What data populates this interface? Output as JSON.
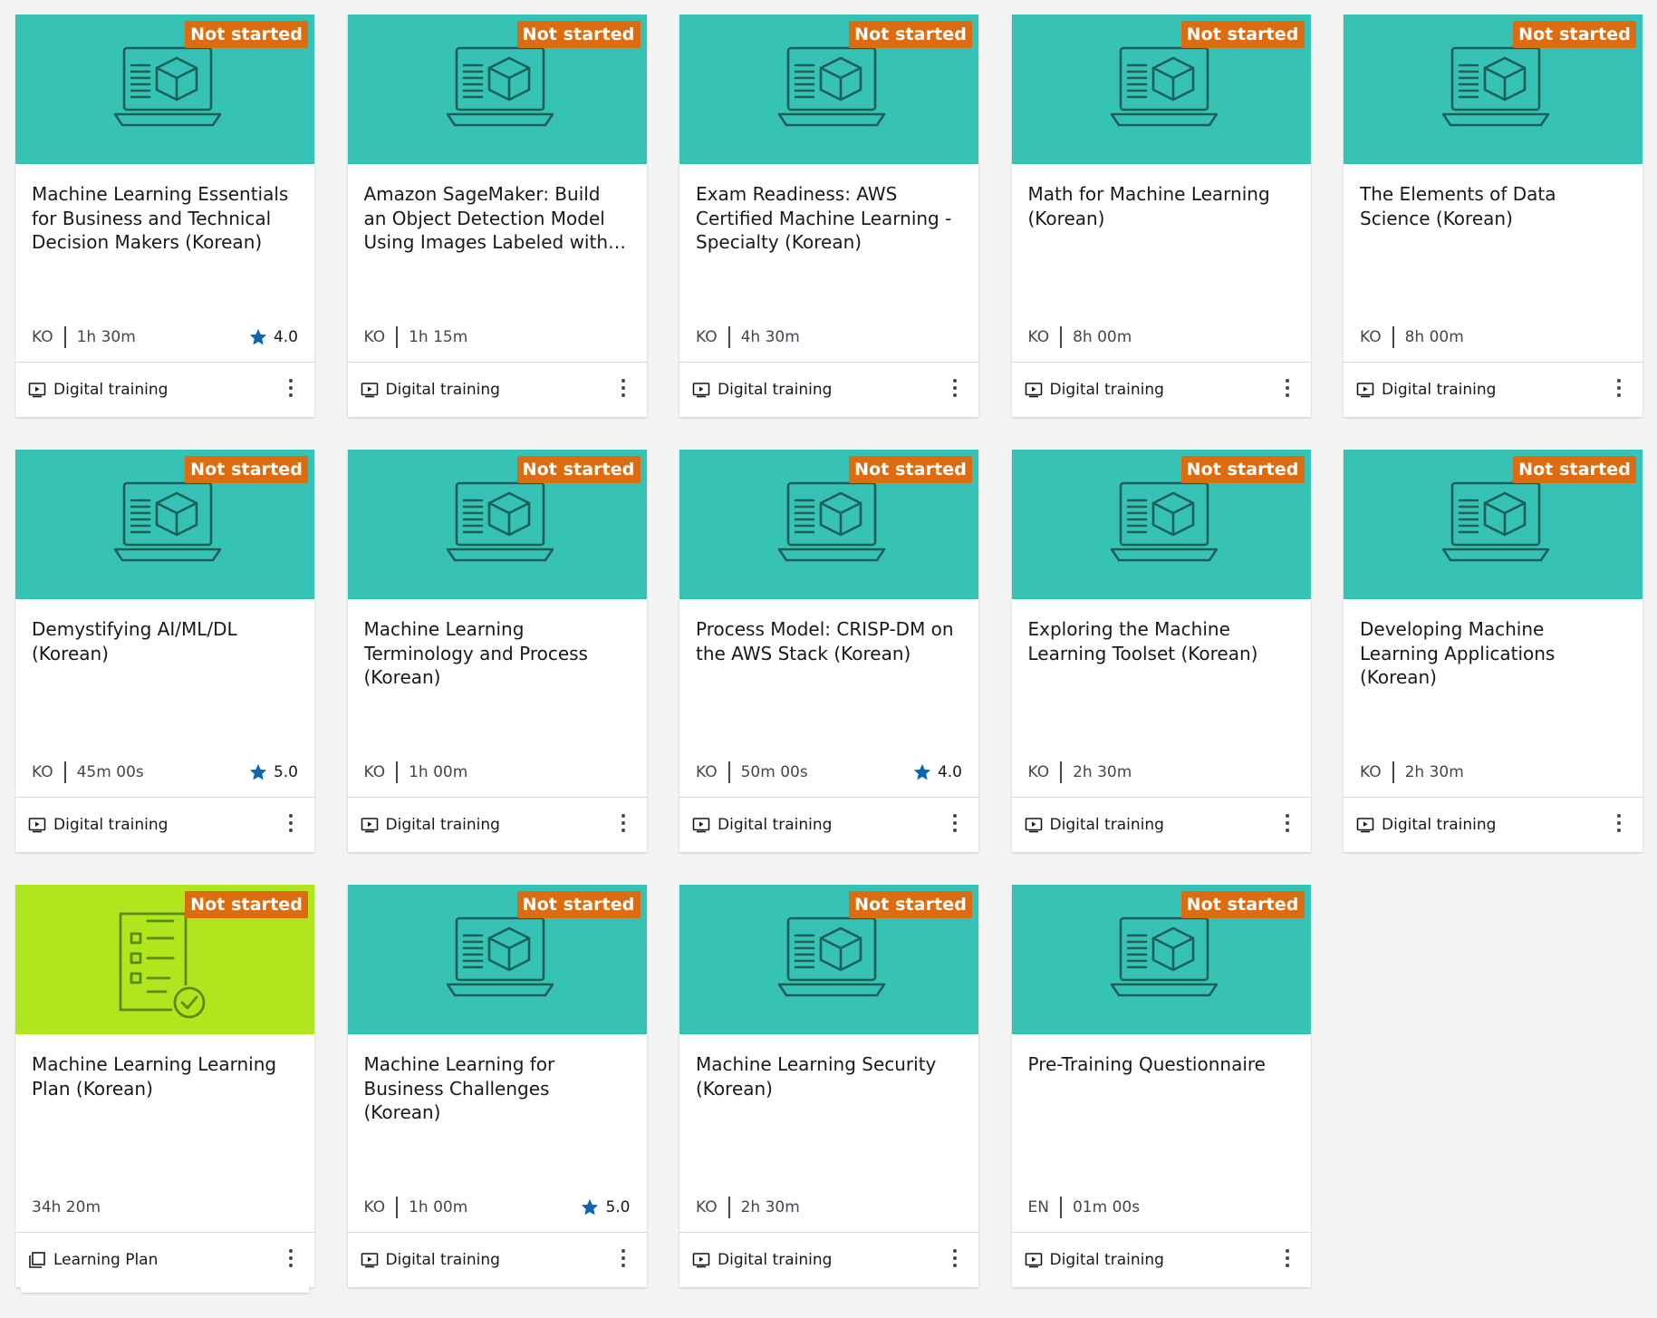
{
  "colors": {
    "header_digital": "#36c2b4",
    "header_plan": "#afe61e",
    "badge": "#dd6b10",
    "star": "#0a66b0"
  },
  "cards": [
    {
      "status": "Not started",
      "title": "Machine Learning Essentials for Business and Technical Decision Makers (Korean)",
      "lang": "KO",
      "duration": "1h 30m",
      "rating": "4.0",
      "type": "Digital training",
      "icon": "laptop-cube-icon",
      "kind": "digital"
    },
    {
      "status": "Not started",
      "title": "Amazon SageMaker: Build an Object Detection Model Using Images Labeled with Ground Truth (Korean)",
      "lang": "KO",
      "duration": "1h 15m",
      "rating": "",
      "type": "Digital training",
      "icon": "laptop-cube-icon",
      "kind": "digital"
    },
    {
      "status": "Not started",
      "title": "Exam Readiness: AWS Certified Machine Learning - Specialty (Korean)",
      "lang": "KO",
      "duration": "4h 30m",
      "rating": "",
      "type": "Digital training",
      "icon": "laptop-cube-icon",
      "kind": "digital"
    },
    {
      "status": "Not started",
      "title": "Math for Machine Learning (Korean)",
      "lang": "KO",
      "duration": "8h 00m",
      "rating": "",
      "type": "Digital training",
      "icon": "laptop-cube-icon",
      "kind": "digital"
    },
    {
      "status": "Not started",
      "title": "The Elements of Data Science (Korean)",
      "lang": "KO",
      "duration": "8h 00m",
      "rating": "",
      "type": "Digital training",
      "icon": "laptop-cube-icon",
      "kind": "digital"
    },
    {
      "status": "Not started",
      "title": "Demystifying AI/ML/DL (Korean)",
      "lang": "KO",
      "duration": "45m 00s",
      "rating": "5.0",
      "type": "Digital training",
      "icon": "laptop-cube-icon",
      "kind": "digital"
    },
    {
      "status": "Not started",
      "title": "Machine Learning Terminology and Process (Korean)",
      "lang": "KO",
      "duration": "1h 00m",
      "rating": "",
      "type": "Digital training",
      "icon": "laptop-cube-icon",
      "kind": "digital"
    },
    {
      "status": "Not started",
      "title": "Process Model: CRISP-DM on the AWS Stack (Korean)",
      "lang": "KO",
      "duration": "50m 00s",
      "rating": "4.0",
      "type": "Digital training",
      "icon": "laptop-cube-icon",
      "kind": "digital"
    },
    {
      "status": "Not started",
      "title": "Exploring the Machine Learning Toolset (Korean)",
      "lang": "KO",
      "duration": "2h 30m",
      "rating": "",
      "type": "Digital training",
      "icon": "laptop-cube-icon",
      "kind": "digital"
    },
    {
      "status": "Not started",
      "title": "Developing Machine Learning Applications (Korean)",
      "lang": "KO",
      "duration": "2h 30m",
      "rating": "",
      "type": "Digital training",
      "icon": "laptop-cube-icon",
      "kind": "digital"
    },
    {
      "status": "Not started",
      "title": "Machine Learning Learning Plan (Korean)",
      "lang": "",
      "duration": "34h 20m",
      "rating": "",
      "type": "Learning Plan",
      "icon": "checklist-icon",
      "kind": "plan"
    },
    {
      "status": "Not started",
      "title": "Machine Learning for Business Challenges (Korean)",
      "lang": "KO",
      "duration": "1h 00m",
      "rating": "5.0",
      "type": "Digital training",
      "icon": "laptop-cube-icon",
      "kind": "digital"
    },
    {
      "status": "Not started",
      "title": "Machine Learning Security (Korean)",
      "lang": "KO",
      "duration": "2h 30m",
      "rating": "",
      "type": "Digital training",
      "icon": "laptop-cube-icon",
      "kind": "digital"
    },
    {
      "status": "Not started",
      "title": "Pre-Training Questionnaire",
      "lang": "EN",
      "duration": "01m 00s",
      "rating": "",
      "type": "Digital training",
      "icon": "laptop-cube-icon",
      "kind": "digital"
    }
  ]
}
